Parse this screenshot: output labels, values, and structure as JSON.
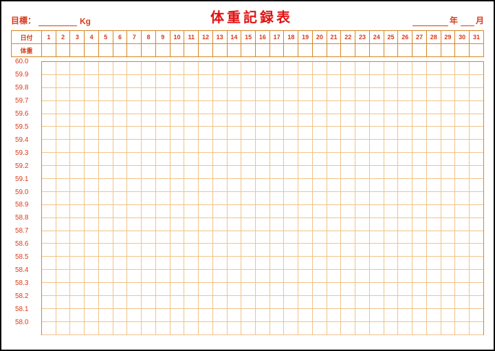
{
  "header": {
    "goal_label": "目標：",
    "kg_label": "Kg",
    "title": "体重記録表",
    "year_label": "年",
    "month_label": "月"
  },
  "table": {
    "date_header": "日付",
    "weight_header": "体重",
    "days": [
      "1",
      "2",
      "3",
      "4",
      "5",
      "6",
      "7",
      "8",
      "9",
      "10",
      "11",
      "12",
      "13",
      "14",
      "15",
      "16",
      "17",
      "18",
      "19",
      "20",
      "21",
      "22",
      "23",
      "24",
      "25",
      "26",
      "27",
      "28",
      "29",
      "30",
      "31"
    ]
  },
  "chart_data": {
    "type": "line",
    "title": "体重記録表",
    "xlabel": "日付",
    "ylabel": "体重",
    "x": [
      1,
      2,
      3,
      4,
      5,
      6,
      7,
      8,
      9,
      10,
      11,
      12,
      13,
      14,
      15,
      16,
      17,
      18,
      19,
      20,
      21,
      22,
      23,
      24,
      25,
      26,
      27,
      28,
      29,
      30,
      31
    ],
    "y_ticks": [
      "60.0",
      "59.9",
      "59.8",
      "59.7",
      "59.6",
      "59.5",
      "59.4",
      "59.3",
      "59.2",
      "59.1",
      "59.0",
      "58.9",
      "58.8",
      "58.7",
      "58.6",
      "58.5",
      "58.4",
      "58.3",
      "58.2",
      "58.1",
      "58.0"
    ],
    "ylim": [
      58.0,
      60.0
    ],
    "series": [
      {
        "name": "体重",
        "values": []
      }
    ]
  }
}
